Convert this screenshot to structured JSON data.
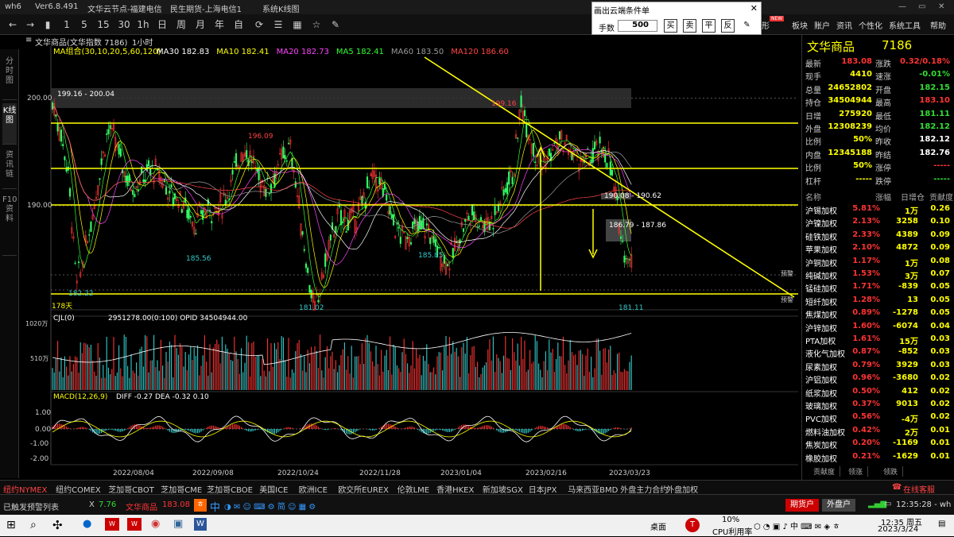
{
  "titlebar": {
    "app": "wh6",
    "version": "Ver6.8.491",
    "node": "文华云节点-福建电信",
    "broker": "民生期货-上海电信1",
    "view": "系统K线图"
  },
  "toolbar": {
    "periods": [
      "15",
      "30",
      "1h",
      "日",
      "周",
      "月",
      "年",
      "自"
    ],
    "icons": [
      "back-icon",
      "forward-icon",
      "refresh-icon",
      "list-icon",
      "layout-icon",
      "star-icon",
      "draw-icon"
    ],
    "right_menu": [
      "形",
      "板块",
      "账户",
      "资讯",
      "个性化",
      "系统工具",
      "帮助"
    ],
    "new_badge": "NEW"
  },
  "cloud": {
    "title": "画出云端条件单",
    "qty_label": "手数",
    "qty_value": "500",
    "buttons": [
      "买",
      "卖",
      "平",
      "反"
    ]
  },
  "leftnav": [
    "分时图",
    "K线图",
    "资讯链",
    "F10资料"
  ],
  "chart": {
    "symbol": "文华商品(文华指数 7186)",
    "period": "1小时",
    "ma_label": "MA组合(30,10,20,5,60,120)",
    "ma": [
      {
        "name": "MA30",
        "value": "182.83",
        "color": "#ffffff"
      },
      {
        "name": "MA10",
        "value": "182.41",
        "color": "#ffff00"
      },
      {
        "name": "MA20",
        "value": "182.73",
        "color": "#ff44ff"
      },
      {
        "name": "MA5",
        "value": "182.41",
        "color": "#33ff33"
      },
      {
        "name": "MA60",
        "value": "183.50",
        "color": "#999999"
      },
      {
        "name": "MA120",
        "value": "186.60",
        "color": "#ff4444"
      }
    ],
    "price_ticks": [
      "200.00",
      "190.00"
    ],
    "annotations": [
      "199.16 - 200.04",
      "199.16",
      "196.09",
      "185.56",
      "185.85",
      "181.02",
      "182.22",
      "190.08 - 190.62",
      "186.79 - 187.86",
      "181.11",
      "178天"
    ],
    "warn_labels": [
      "预警",
      "预警"
    ],
    "vol_label": "CJL(0)",
    "vol_info": "2951278.00(0:100)  OPID 34504944.00",
    "vol_ticks": [
      "1020万",
      "510万"
    ],
    "macd_label": "MACD(12,26,9)",
    "macd_vals": "DIFF -0.27  DEA -0.32  0.10",
    "macd_ticks": [
      "1.00",
      "0.00",
      "-1.00",
      "-2.00"
    ],
    "dates": [
      "2022/08/04",
      "2022/09/08",
      "2022/10/24",
      "2022/11/28",
      "2023/01/04",
      "2023/02/16",
      "2023/03/23"
    ]
  },
  "quote": {
    "name": "文华商品",
    "code": "7186",
    "rows": [
      {
        "l1": "最新",
        "v1": "183.08",
        "c1": "#ff3333",
        "l2": "涨跌",
        "v2": "0.32/0.18%",
        "c2": "#ff3333"
      },
      {
        "l1": "现手",
        "v1": "4410",
        "c1": "#ffff00",
        "l2": "速涨",
        "v2": "-0.01%",
        "c2": "#33dd33"
      },
      {
        "l1": "总量",
        "v1": "24652802",
        "c1": "#ffff00",
        "l2": "开盘",
        "v2": "182.15",
        "c2": "#33dd33"
      },
      {
        "l1": "持仓",
        "v1": "34504944",
        "c1": "#ffff00",
        "l2": "最高",
        "v2": "183.10",
        "c2": "#ff3333"
      },
      {
        "l1": "日增",
        "v1": "275920",
        "c1": "#ffff00",
        "l2": "最低",
        "v2": "181.11",
        "c2": "#33dd33"
      },
      {
        "l1": "外盘",
        "v1": "12308239",
        "c1": "#ffff00",
        "l2": "均价",
        "v2": "182.12",
        "c2": "#33dd33"
      },
      {
        "l1": "比例",
        "v1": "50%",
        "c1": "#ffff00",
        "l2": "昨收",
        "v2": "182.12",
        "c2": "#ffffff"
      },
      {
        "l1": "内盘",
        "v1": "12345188",
        "c1": "#ffff00",
        "l2": "昨结",
        "v2": "182.76",
        "c2": "#ffffff"
      },
      {
        "l1": "比例",
        "v1": "50%",
        "c1": "#ffff00",
        "l2": "涨停",
        "v2": "-----",
        "c2": "#ff3333"
      },
      {
        "l1": "杠杆",
        "v1": "-----",
        "c1": "#ffff00",
        "l2": "跌停",
        "v2": "-----",
        "c2": "#33dd33"
      }
    ]
  },
  "list": {
    "headers": [
      "名称",
      "涨幅",
      "日增仓",
      "贡献度"
    ],
    "rows": [
      [
        "沪锡加权",
        "5.81%",
        "1万",
        "0.26"
      ],
      [
        "沪镍加权",
        "2.13%",
        "3258",
        "0.10"
      ],
      [
        "硅铁加权",
        "2.33%",
        "4389",
        "0.09"
      ],
      [
        "苹果加权",
        "2.10%",
        "4872",
        "0.09"
      ],
      [
        "沪铜加权",
        "1.17%",
        "1万",
        "0.08"
      ],
      [
        "纯碱加权",
        "1.53%",
        "3万",
        "0.07"
      ],
      [
        "锰硅加权",
        "1.71%",
        "-839",
        "0.05"
      ],
      [
        "短纤加权",
        "1.28%",
        "13",
        "0.05"
      ],
      [
        "焦煤加权",
        "0.89%",
        "-1278",
        "0.05"
      ],
      [
        "沪锌加权",
        "1.60%",
        "-6074",
        "0.04"
      ],
      [
        "PTA加权",
        "1.61%",
        "15万",
        "0.03"
      ],
      [
        "液化气加权",
        "0.87%",
        "-852",
        "0.03"
      ],
      [
        "尿素加权",
        "0.79%",
        "3929",
        "0.03"
      ],
      [
        "沪铝加权",
        "0.96%",
        "-3680",
        "0.02"
      ],
      [
        "纸浆加权",
        "0.50%",
        "412",
        "0.02"
      ],
      [
        "玻璃加权",
        "0.37%",
        "9013",
        "0.02"
      ],
      [
        "PVC加权",
        "0.56%",
        "-4万",
        "0.02"
      ],
      [
        "燃料油加权",
        "0.42%",
        "2万",
        "0.01"
      ],
      [
        "焦炭加权",
        "0.20%",
        "-1169",
        "0.01"
      ],
      [
        "橡胶加权",
        "0.21%",
        "-1629",
        "0.01"
      ]
    ],
    "tabs": [
      "贡献度",
      "领涨",
      "领跌"
    ]
  },
  "exchanges": [
    "纽约NYMEX",
    "纽约COMEX",
    "芝加哥CBOT",
    "芝加哥CME",
    "芝加哥CBOE",
    "美国ICE",
    "欧洲ICE",
    "欧交所EUREX",
    "伦敦LME",
    "香港HKEX",
    "新加坡SGX",
    "日本JPX",
    "马来西亚BMD",
    "外盘主力合约",
    "外盘加权"
  ],
  "online": "在线客服",
  "status": {
    "alert": "已触发预警列表",
    "close": "X",
    "price_prev": "7.76",
    "ticker": "文华商品",
    "ticker_price": "183.08",
    "ime": "中",
    "btn1": "期货户",
    "btn2": "外盘户",
    "time": "12:35:28 - wh"
  },
  "taskbar": {
    "desktop": "桌面",
    "cpu_pct": "10%",
    "cpu_label": "CPU利用率",
    "clock_time": "12:35 周五",
    "clock_date": "2023/3/24"
  }
}
